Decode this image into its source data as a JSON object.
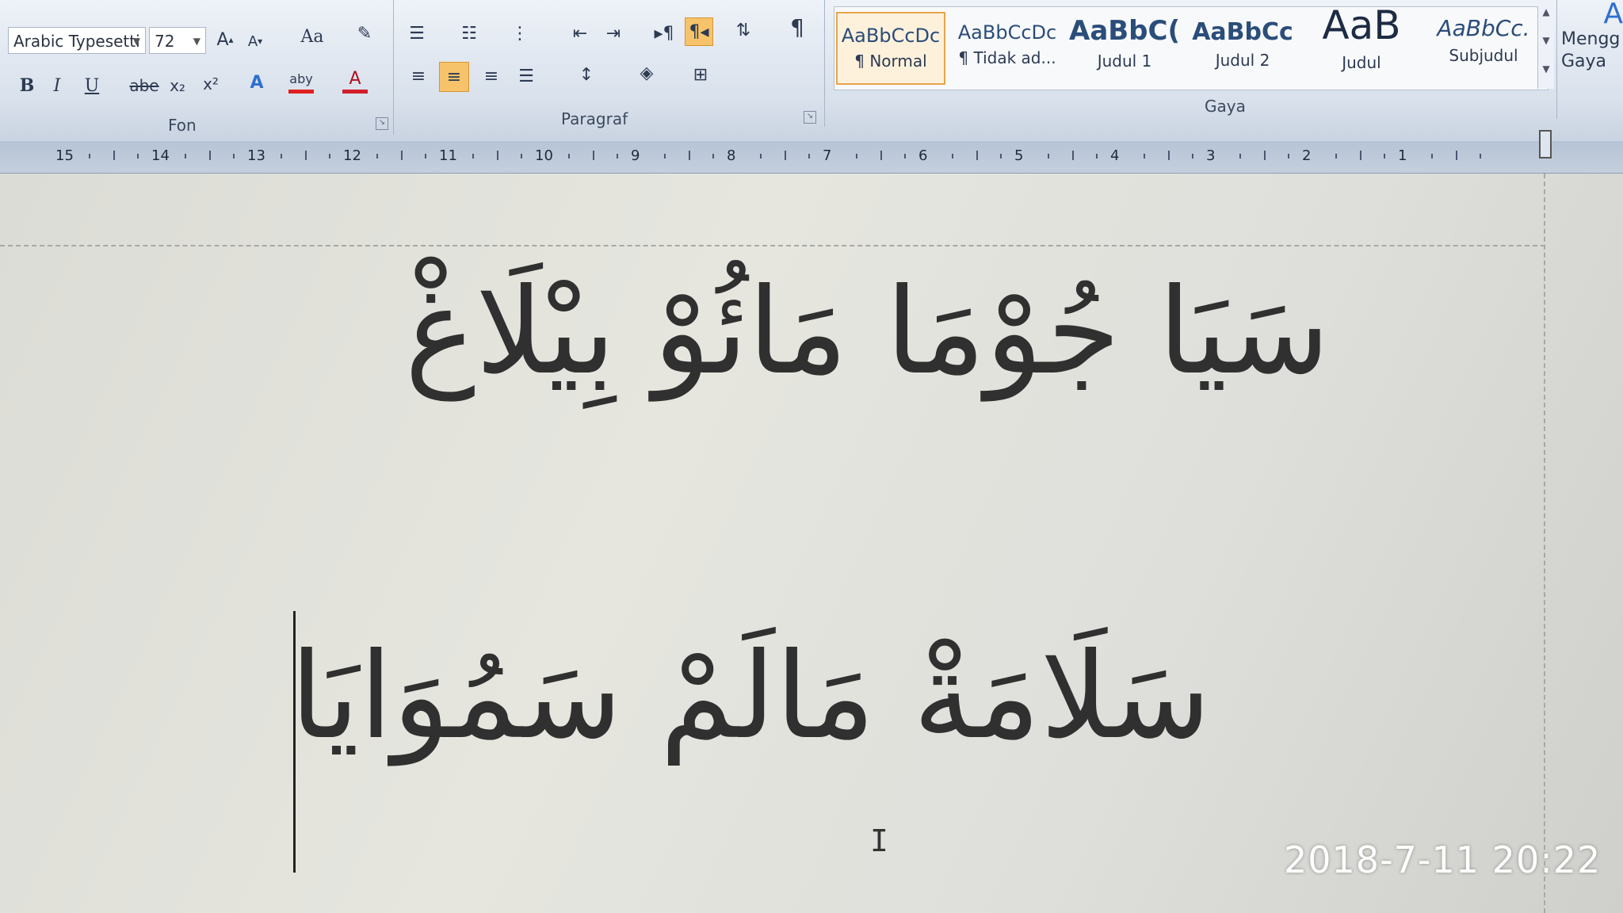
{
  "ribbon": {
    "font_group": {
      "label": "Fon",
      "font_name": "Arabic Typesetti",
      "font_size": "72",
      "grow_label": "A",
      "shrink_label": "A",
      "change_case_label": "Aa",
      "bold_label": "B",
      "italic_label": "I",
      "underline_label": "U",
      "strike_label": "abe",
      "subscript_label": "x₂",
      "superscript_label": "x²",
      "effects_label": "A",
      "highlight_label": "aby",
      "font_color_label": "A"
    },
    "paragraph_group": {
      "label": "Paragraf"
    },
    "styles_group": {
      "label": "Gaya",
      "items": [
        {
          "sample": "AaBbCcDc",
          "name": "¶ Normal"
        },
        {
          "sample": "AaBbCcDc",
          "name": "¶ Tidak ad..."
        },
        {
          "sample": "AaBbC(",
          "name": "Judul 1"
        },
        {
          "sample": "AaBbCc",
          "name": "Judul 2"
        },
        {
          "sample": "AaB",
          "name": "Judul"
        },
        {
          "sample": "AaBbCc.",
          "name": "Subjudul"
        }
      ],
      "change_styles_label": "Mengg Gaya"
    },
    "colors": {
      "active_button": "#f6c36b",
      "highlight_bar": "#e02020",
      "font_color_bar": "#d21f2a",
      "style_text": "#2b4d7a"
    }
  },
  "ruler": {
    "numbers": [
      "15",
      "14",
      "13",
      "12",
      "11",
      "10",
      "9",
      "8",
      "7",
      "6",
      "5",
      "4",
      "3",
      "2",
      "1"
    ]
  },
  "document": {
    "line1": "سَيَا جُوْمَا مَائُوْ بِيْلَاغْ",
    "line2": "سَلَامَةْ مَالَمْ سَمُوَايَا"
  },
  "overlay": {
    "timestamp": "2018-7-11 20:22"
  }
}
